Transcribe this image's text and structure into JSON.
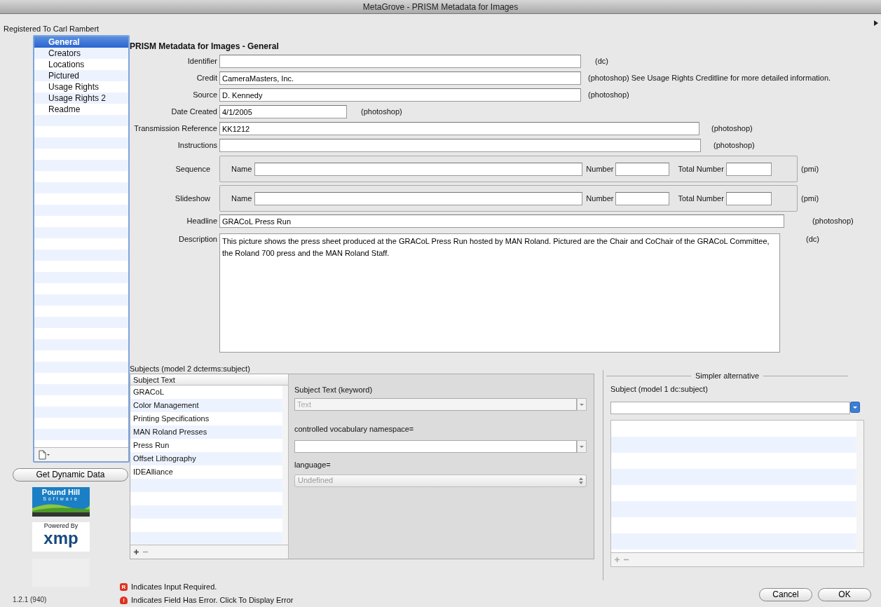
{
  "window": {
    "title": "MetaGrove - PRISM Metadata for Images"
  },
  "registration": "Registered To Carl Rambert",
  "sidebar": {
    "items": [
      {
        "label": "General",
        "selected": true
      },
      {
        "label": "Creators",
        "selected": false
      },
      {
        "label": "Locations",
        "selected": false
      },
      {
        "label": "Pictured",
        "selected": false
      },
      {
        "label": "Usage Rights",
        "selected": false
      },
      {
        "label": "Usage Rights 2",
        "selected": false
      },
      {
        "label": "Readme",
        "selected": false
      }
    ],
    "button": "Get Dynamic Data"
  },
  "logos": {
    "vendor_name": "Pound Hill",
    "vendor_sub": "Software",
    "powered_by": "Powered By",
    "platform": "xmp"
  },
  "version": "1.2.1 (940)",
  "form": {
    "heading": "PRISM Metadata for Images - General",
    "fields": [
      {
        "kind": "text",
        "label": "Identifier",
        "note": "(dc)"
      },
      {
        "kind": "text",
        "label": "Credit",
        "value": "CameraMasters, Inc.",
        "note": "(photoshop) See Usage Rights Creditline for more detailed information."
      },
      {
        "kind": "text",
        "label": "Source",
        "value": "D. Kennedy",
        "note": "(photoshop)"
      },
      {
        "kind": "text",
        "label": "Date Created",
        "value": "4/1/2005",
        "note": "(photoshop)"
      },
      {
        "kind": "text",
        "label": "Transmission Reference",
        "value": "KK1212",
        "note": "(photoshop)"
      },
      {
        "kind": "text",
        "label": "Instructions",
        "note": "(photoshop)"
      },
      {
        "kind": "group",
        "label": "Sequence",
        "name_label": "Name",
        "number_label": "Number",
        "total_label": "Total Number",
        "note": "(pmi)"
      },
      {
        "kind": "group",
        "label": "Slideshow",
        "name_label": "Name",
        "number_label": "Number",
        "total_label": "Total Number",
        "note": "(pmi)"
      },
      {
        "kind": "text",
        "label": "Headline",
        "value": "GRACoL Press Run",
        "note": "(photoshop)"
      },
      {
        "kind": "textarea",
        "label": "Description",
        "value": "This picture shows the press sheet produced at the GRACoL Press Run hosted by MAN Roland. Pictured are the Chair and CoChair of the GRACoL Committee, the Roland 700 press and the MAN Roland Staff.",
        "note": "(dc)"
      }
    ]
  },
  "subjects": {
    "title": "Subjects (model 2 dcterms:subject)",
    "column": "Subject Text",
    "rows": [
      "GRACoL",
      "Color Management",
      "Printing Specifications",
      "MAN Roland Presses",
      "Press Run",
      "Offset Lithography",
      "IDEAlliance"
    ],
    "editor": {
      "keyword_label": "Subject Text (keyword)",
      "keyword_placeholder": "Text",
      "keyword_disabled": true,
      "namespace_label": "controlled vocabulary namespace=",
      "language_label": "language=",
      "language_value": "Undefined",
      "language_disabled": true
    }
  },
  "simpler": {
    "legend": "Simpler alternative",
    "label": "Subject (model 1 dc:subject)"
  },
  "legend": [
    {
      "kind": "required",
      "badge": "R",
      "text": "Indicates Input Required."
    },
    {
      "kind": "error",
      "badge": "!",
      "text": "Indicates Field Has Error. Click To Display Error"
    }
  ],
  "buttons": [
    "Cancel",
    "OK"
  ]
}
